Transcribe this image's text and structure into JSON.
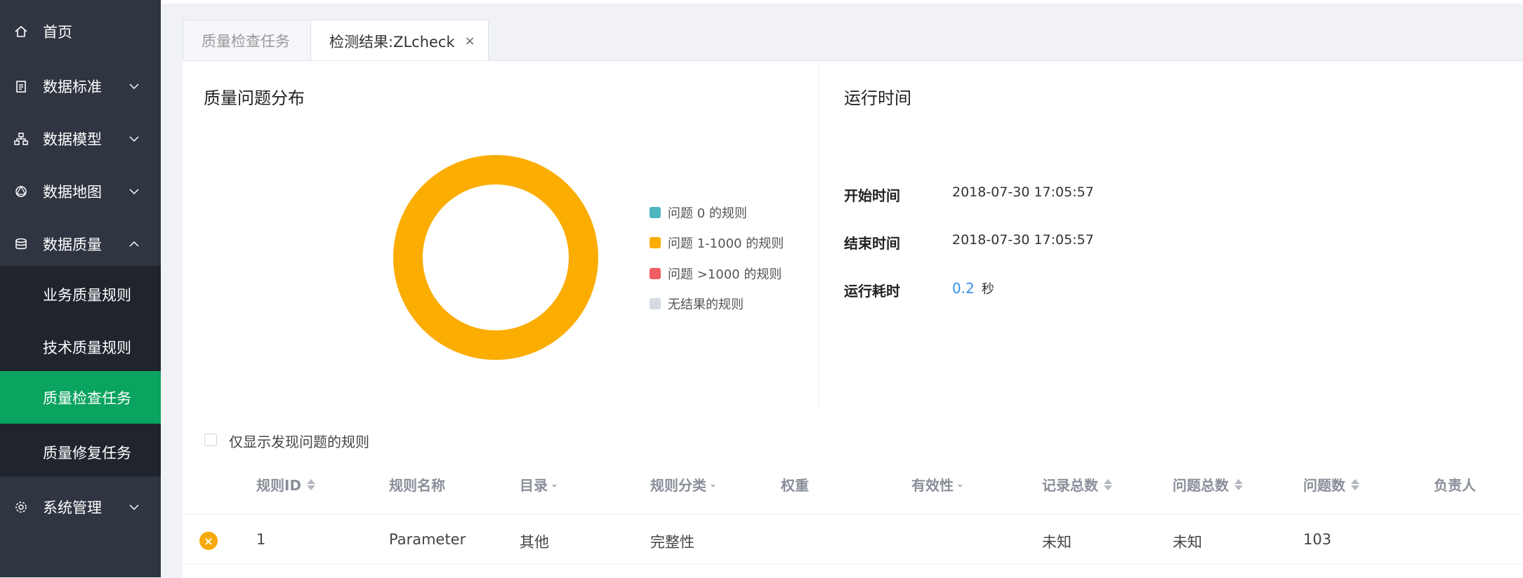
{
  "sidebar": {
    "items": [
      {
        "label": "首页",
        "icon": "home-icon"
      },
      {
        "label": "数据标准",
        "icon": "clipboard-icon"
      },
      {
        "label": "数据模型",
        "icon": "hierarchy-icon"
      },
      {
        "label": "数据地图",
        "icon": "map-network-icon"
      },
      {
        "label": "数据质量",
        "icon": "database-icon"
      },
      {
        "label": "系统管理",
        "icon": "gear-icon"
      }
    ],
    "submenu": [
      {
        "label": "业务质量规则"
      },
      {
        "label": "技术质量规则"
      },
      {
        "label": "质量检查任务",
        "active": true
      },
      {
        "label": "质量修复任务"
      }
    ]
  },
  "tabs": [
    {
      "label": "质量检查任务"
    },
    {
      "label": "检测结果:ZLcheck",
      "close": "×"
    }
  ],
  "distribution": {
    "title": "质量问题分布",
    "legend": [
      {
        "label": "问题 0 的规则",
        "color": "#4db6c0"
      },
      {
        "label": "问题 1-1000 的规则",
        "color": "#fbad02"
      },
      {
        "label": "问题 >1000 的规则",
        "color": "#f25d62"
      },
      {
        "label": "无结果的规则",
        "color": "#d5dae3"
      }
    ]
  },
  "chart_data": {
    "type": "pie",
    "categories": [
      "问题 0 的规则",
      "问题 1-1000 的规则",
      "问题 >1000 的规则",
      "无结果的规则"
    ],
    "values": [
      0,
      1,
      0,
      0
    ],
    "colors": [
      "#4db6c0",
      "#fbad02",
      "#f25d62",
      "#d5dae3"
    ],
    "donut": true
  },
  "runtime": {
    "title": "运行时间",
    "start_label": "开始时间",
    "start_value": "2018-07-30 17:05:57",
    "end_label": "结束时间",
    "end_value": "2018-07-30 17:05:57",
    "duration_label": "运行耗时",
    "duration_value": "0.2",
    "duration_unit": "秒"
  },
  "filter": {
    "label": "仅显示发现问题的规则",
    "checked": false
  },
  "table": {
    "columns": [
      "规则ID",
      "规则名称",
      "目录",
      "规则分类",
      "权重",
      "有效性",
      "记录总数",
      "问题总数",
      "问题数",
      "负责人"
    ],
    "rows": [
      {
        "status_icon": "×",
        "id": "1",
        "name": "Parameter",
        "catalog": "其他",
        "category": "完整性",
        "weight": "",
        "validity": "",
        "total_records": "未知",
        "total_issues": "未知",
        "issues": "103",
        "owner": ""
      }
    ]
  }
}
